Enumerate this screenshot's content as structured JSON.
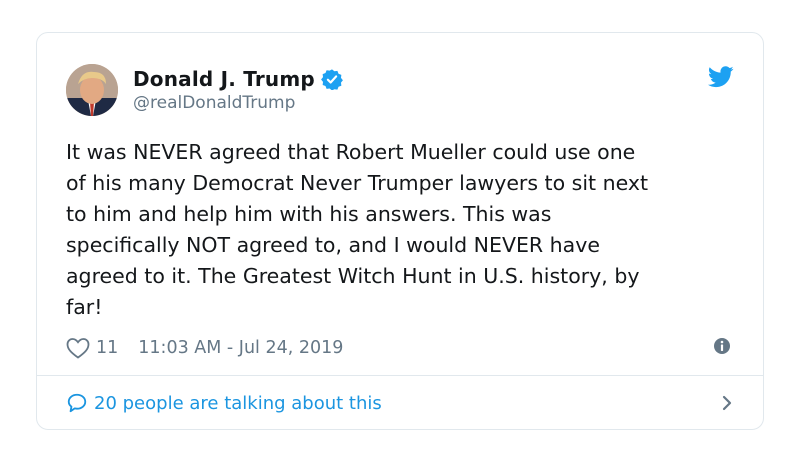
{
  "tweet": {
    "author": {
      "display_name": "Donald J. Trump",
      "handle": "@realDonaldTrump",
      "verified": true
    },
    "text": "It was NEVER agreed that Robert Mueller could use one\nof his many Democrat Never Trumper lawyers to sit next\nto him and help him with his answers. This was\nspecifically NOT agreed to, and I would NEVER have\nagreed to it. The Greatest Witch Hunt in U.S. history, by\nfar!",
    "likes": "11",
    "timestamp": "11:03 AM - Jul 24, 2019",
    "talking": "20 people are talking about this"
  },
  "colors": {
    "twitter_blue": "#1da1f2",
    "link_blue": "#1b95e0",
    "muted": "#657786",
    "border": "#e1e8ed"
  },
  "icons": [
    "twitter-bird-icon",
    "verified-badge-icon",
    "heart-icon",
    "info-icon",
    "speech-bubble-icon",
    "chevron-right-icon"
  ]
}
